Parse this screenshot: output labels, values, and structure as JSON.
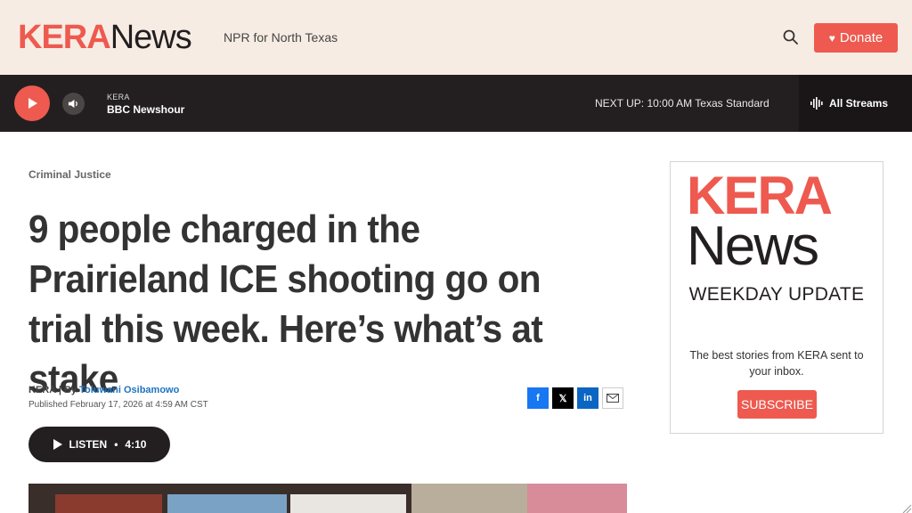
{
  "header": {
    "logo_kera": "KERA",
    "logo_news": "News",
    "tagline": "NPR for North Texas",
    "search_icon": "search-icon",
    "donate_label": "Donate",
    "brand_color": "#ee5a4f"
  },
  "player": {
    "station": "KERA",
    "program": "BBC Newshour",
    "next_up": "NEXT UP: 10:00 AM Texas Standard",
    "all_streams": "All Streams"
  },
  "article": {
    "category": "Criminal Justice",
    "headline": "9 people charged in the Prairieland ICE shooting go on trial this week. Here’s what’s at stake",
    "byline_source": "KERA | By ",
    "author": "Toluwani Osibamowo",
    "published": "Published February 17, 2026 at 4:59 AM CST",
    "share": {
      "facebook": "f",
      "x": "𝕏",
      "linkedin": "in"
    },
    "listen_label": "LISTEN",
    "listen_separator": "•",
    "listen_duration": "4:10"
  },
  "promo": {
    "logo_kera": "KERA",
    "logo_news": "News",
    "weekday": "WEEKDAY UPDATE",
    "description": "The best stories from KERA sent to your inbox.",
    "subscribe_label": "SUBSCRIBE"
  }
}
